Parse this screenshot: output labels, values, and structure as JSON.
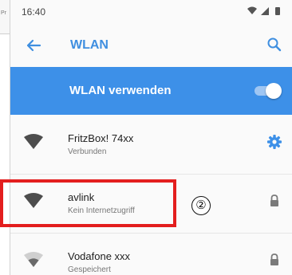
{
  "doc_fragment": {
    "text": "Pr"
  },
  "status_bar": {
    "time": "16:40",
    "icons": [
      "wifi-icon",
      "signal-icon",
      "battery-icon"
    ]
  },
  "app_bar": {
    "title": "WLAN",
    "back_icon": "arrow-back-icon",
    "search_icon": "search-icon"
  },
  "master_switch": {
    "label": "WLAN verwenden",
    "enabled": true
  },
  "networks": [
    {
      "name": "FritzBox! 74xx",
      "status": "Verbunden",
      "action_icon": "gear-icon"
    },
    {
      "name": "avlink",
      "status": "Kein Internetzugriff",
      "action_icon": "lock-icon"
    },
    {
      "name": "Vodafone xxx",
      "status": "Gespeichert",
      "action_icon": "lock-icon"
    }
  ],
  "annotation": {
    "step_label": "②"
  },
  "colors": {
    "accent": "#3d90e8",
    "title": "#3f8fe0",
    "highlight": "#e31e1e"
  }
}
